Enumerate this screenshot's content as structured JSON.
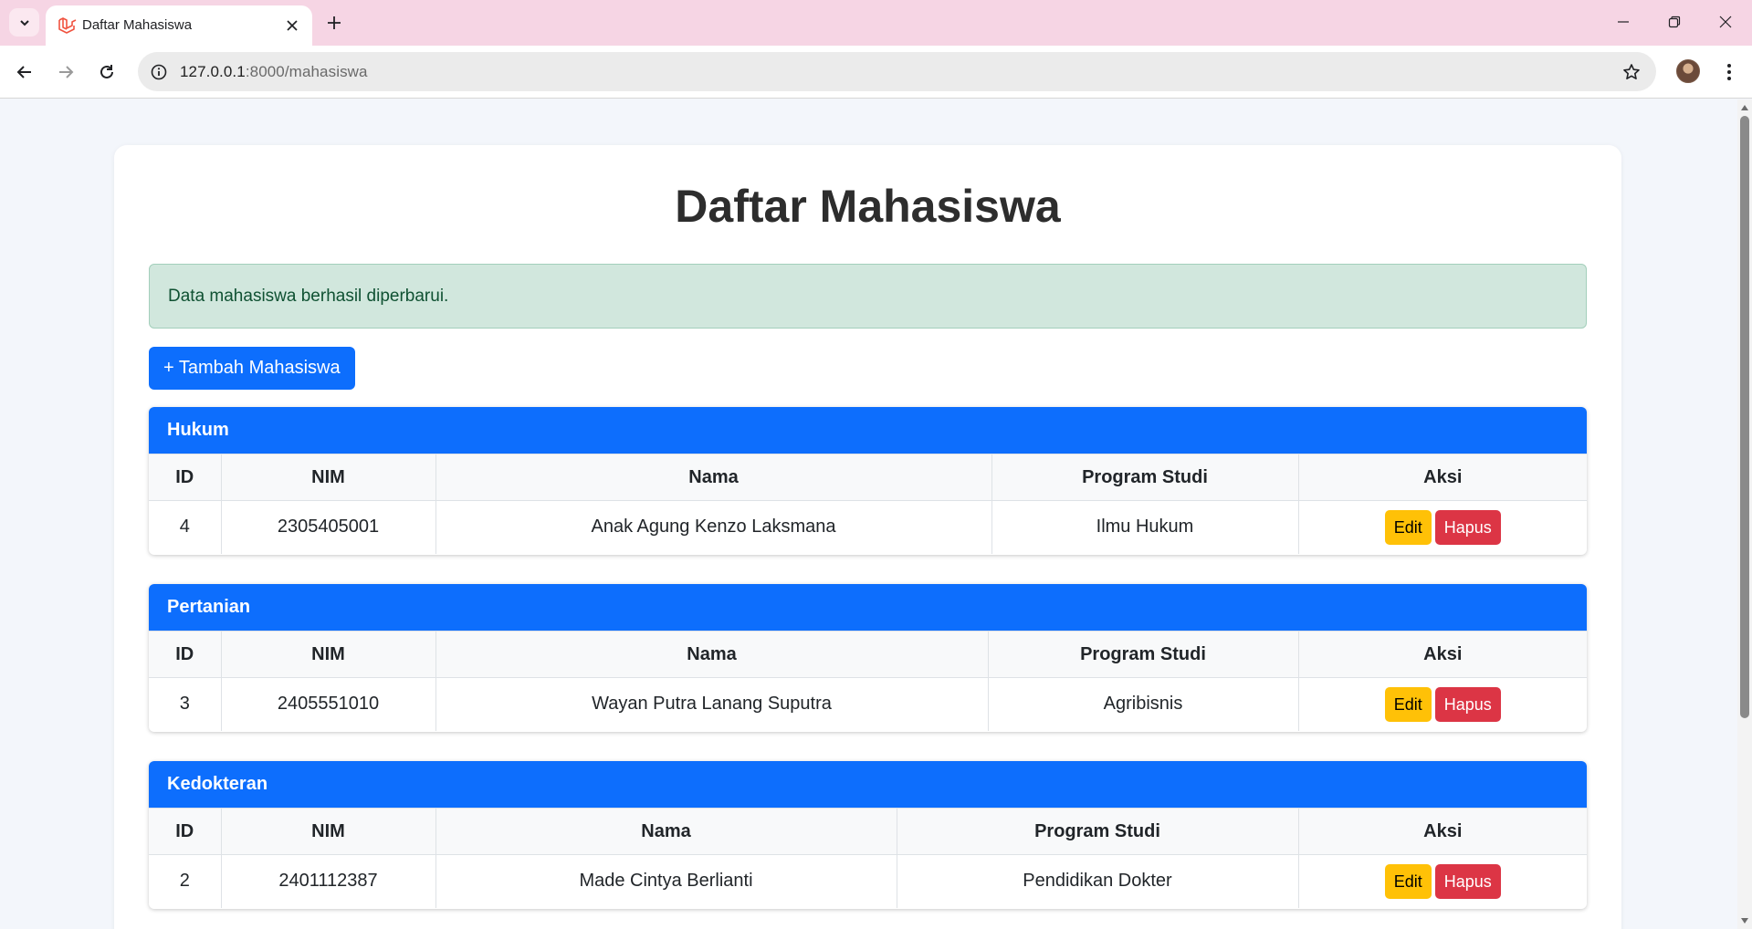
{
  "browser": {
    "tab_title": "Daftar Mahasiswa",
    "url_host": "127.0.0.1",
    "url_path": ":8000/mahasiswa",
    "icons": [
      "tab-search-icon",
      "laravel-favicon-icon",
      "close-icon",
      "plus-icon",
      "minimize-icon",
      "restore-icon",
      "close-window-icon",
      "back-icon",
      "forward-icon",
      "reload-icon",
      "site-info-icon",
      "star-icon",
      "kebab-menu-icon"
    ]
  },
  "page": {
    "title": "Daftar Mahasiswa",
    "alert": "Data mahasiswa berhasil diperbarui.",
    "add_button": "+ Tambah Mahasiswa"
  },
  "colors": {
    "primary": "#0d6efd",
    "success_bg": "#d1e7dd",
    "success_text": "#0f5132",
    "warning": "#ffc107",
    "danger": "#dc3545"
  },
  "table_headers": [
    "ID",
    "NIM",
    "Nama",
    "Program Studi",
    "Aksi"
  ],
  "groups": [
    {
      "name": "Hukum",
      "rows": [
        {
          "id": "4",
          "nim": "2305405001",
          "nama": "Anak Agung Kenzo Laksmana",
          "prodi": "Ilmu Hukum",
          "edit": "Edit",
          "hapus": "Hapus"
        }
      ]
    },
    {
      "name": "Pertanian",
      "rows": [
        {
          "id": "3",
          "nim": "2405551010",
          "nama": "Wayan Putra Lanang Suputra",
          "prodi": "Agribisnis",
          "edit": "Edit",
          "hapus": "Hapus"
        }
      ]
    },
    {
      "name": "Kedokteran",
      "rows": [
        {
          "id": "2",
          "nim": "2401112387",
          "nama": "Made Cintya Berlianti",
          "prodi": "Pendidikan Dokter",
          "edit": "Edit",
          "hapus": "Hapus"
        }
      ]
    }
  ]
}
